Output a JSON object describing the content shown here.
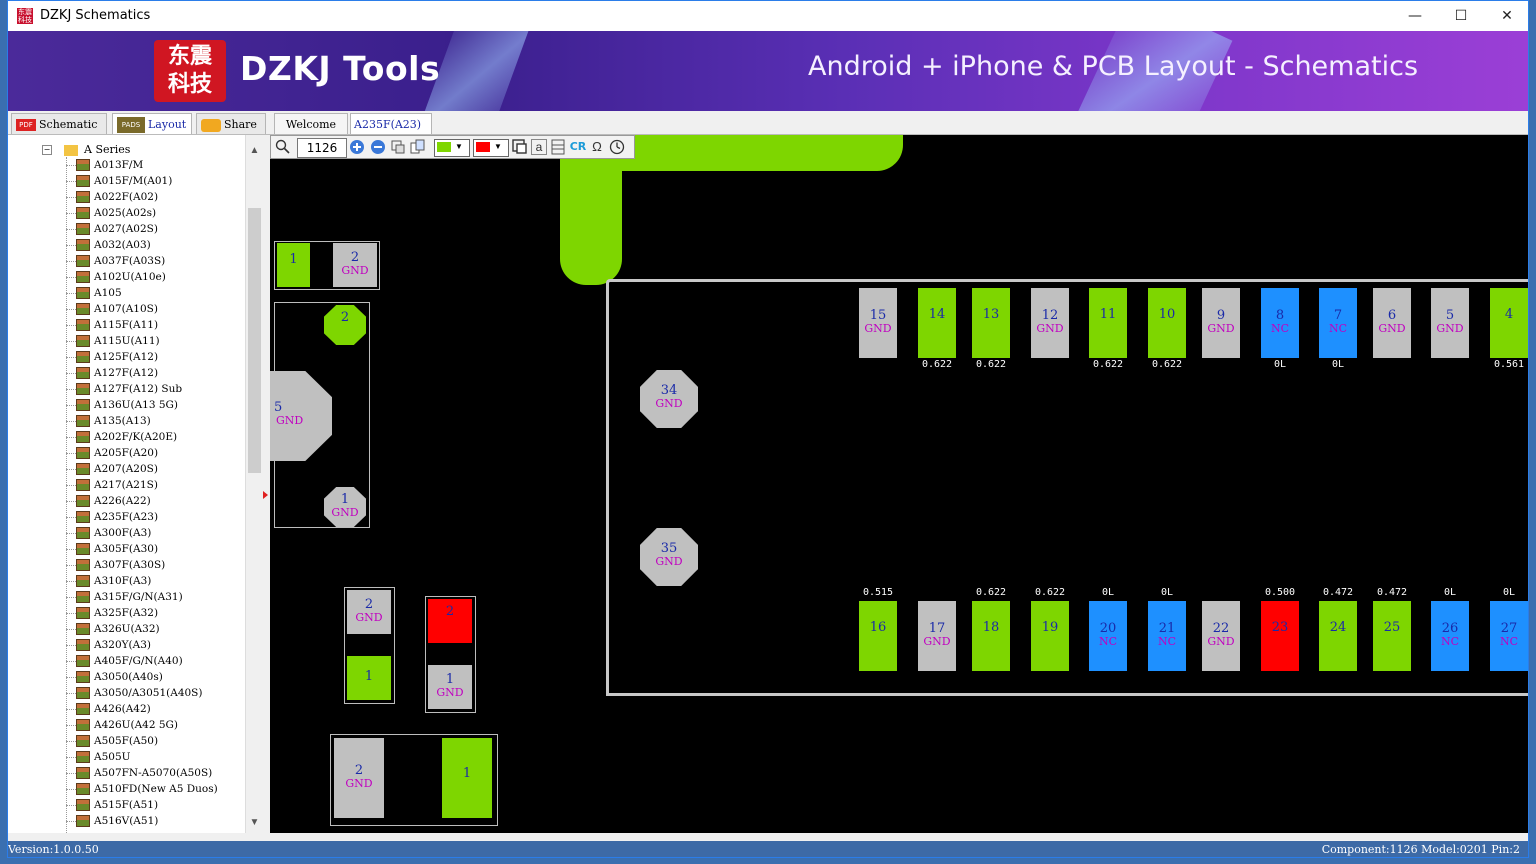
{
  "window": {
    "title": "DZKJ Schematics",
    "minimize": "—",
    "maximize": "☐",
    "close": "✕"
  },
  "banner": {
    "logo_text": "东震科技",
    "brand": "DZKJ Tools",
    "tagline": "Android + iPhone & PCB Layout - Schematics"
  },
  "tabs": {
    "schematic": "Schematic",
    "layout": "Layout",
    "share": "Share",
    "welcome": "Welcome",
    "doc": "A235F(A23)",
    "pdf_icon": "PDF",
    "pads_icon": "PADS"
  },
  "tree": {
    "series": "A Series",
    "items": [
      "A013F/M",
      "A015F/M(A01)",
      "A022F(A02)",
      "A025(A02s)",
      "A027(A02S)",
      "A032(A03)",
      "A037F(A03S)",
      "A102U(A10e)",
      "A105",
      "A107(A10S)",
      "A115F(A11)",
      "A115U(A11)",
      "A125F(A12)",
      "A127F(A12)",
      "A127F(A12) Sub",
      "A136U(A13 5G)",
      "A135(A13)",
      "A202F/K(A20E)",
      "A205F(A20)",
      "A207(A20S)",
      "A217(A21S)",
      "A226(A22)",
      "A235F(A23)",
      "A300F(A3)",
      "A305F(A30)",
      "A307F(A30S)",
      "A310F(A3)",
      "A315F/G/N(A31)",
      "A325F(A32)",
      "A326U(A32)",
      "A320Y(A3)",
      "A405F/G/N(A40)",
      "A3050(A40s)",
      "A3050/A3051(A40S)",
      "A426(A42)",
      "A426U(A42 5G)",
      "A505F(A50)",
      "A505U",
      "A507FN-A5070(A50S)",
      "A510FD(New A5 Duos)",
      "A515F(A51)",
      "A516V(A51)"
    ]
  },
  "toolbar": {
    "zoom_value": "1126",
    "search_icon": "magnifier-icon",
    "cr_label": "CR",
    "omega_label": "Ω",
    "colors": {
      "fill_a": "#7ed600",
      "fill_b": "#ff0000"
    }
  },
  "pads": {
    "top_row": [
      {
        "num": "15",
        "net": "GND",
        "color": "s",
        "meas": ""
      },
      {
        "num": "14",
        "net": "",
        "color": "g",
        "meas": "0.622"
      },
      {
        "num": "13",
        "net": "",
        "color": "g",
        "meas": "0.622"
      },
      {
        "num": "12",
        "net": "GND",
        "color": "s",
        "meas": ""
      },
      {
        "num": "11",
        "net": "",
        "color": "g",
        "meas": "0.622"
      },
      {
        "num": "10",
        "net": "",
        "color": "g",
        "meas": "0.622"
      },
      {
        "num": "9",
        "net": "GND",
        "color": "s",
        "meas": ""
      },
      {
        "num": "8",
        "net": "NC",
        "color": "b",
        "meas": "0L"
      },
      {
        "num": "7",
        "net": "NC",
        "color": "b",
        "meas": "0L"
      },
      {
        "num": "6",
        "net": "GND",
        "color": "s",
        "meas": ""
      },
      {
        "num": "5",
        "net": "GND",
        "color": "s",
        "meas": ""
      },
      {
        "num": "4",
        "net": "",
        "color": "g",
        "meas": "0.561"
      }
    ],
    "bottom_row": [
      {
        "num": "16",
        "net": "",
        "color": "g",
        "meas": "0.515"
      },
      {
        "num": "17",
        "net": "GND",
        "color": "s",
        "meas": ""
      },
      {
        "num": "18",
        "net": "",
        "color": "g",
        "meas": "0.622"
      },
      {
        "num": "19",
        "net": "",
        "color": "g",
        "meas": "0.622"
      },
      {
        "num": "20",
        "net": "NC",
        "color": "b",
        "meas": "0L"
      },
      {
        "num": "21",
        "net": "NC",
        "color": "b",
        "meas": "0L"
      },
      {
        "num": "22",
        "net": "GND",
        "color": "s",
        "meas": ""
      },
      {
        "num": "23",
        "net": "",
        "color": "r",
        "meas": "0.500"
      },
      {
        "num": "24",
        "net": "",
        "color": "g",
        "meas": "0.472"
      },
      {
        "num": "25",
        "net": "",
        "color": "g",
        "meas": "0.472"
      },
      {
        "num": "26",
        "net": "NC",
        "color": "b",
        "meas": "0L"
      },
      {
        "num": "27",
        "net": "NC",
        "color": "b",
        "meas": "0L"
      }
    ],
    "p34": {
      "num": "34",
      "net": "GND"
    },
    "p35": {
      "num": "35",
      "net": "GND"
    },
    "left_c1": {
      "p1": "1",
      "p2": "2",
      "p2net": "GND"
    },
    "left_ic": {
      "p2": "2",
      "p5": "5",
      "p5net": "GND",
      "p1": "1",
      "p1net": "GND"
    },
    "cap_a": {
      "p2": "2",
      "p2net": "GND",
      "p1": "1"
    },
    "cap_b": {
      "p2": "2",
      "p1": "1",
      "p1net": "GND"
    },
    "cap_c": {
      "p2": "2",
      "p2net": "GND",
      "p1": "1"
    }
  },
  "status": {
    "version": "Version:1.0.0.50",
    "info": "Component:1126 Model:0201 Pin:2"
  }
}
